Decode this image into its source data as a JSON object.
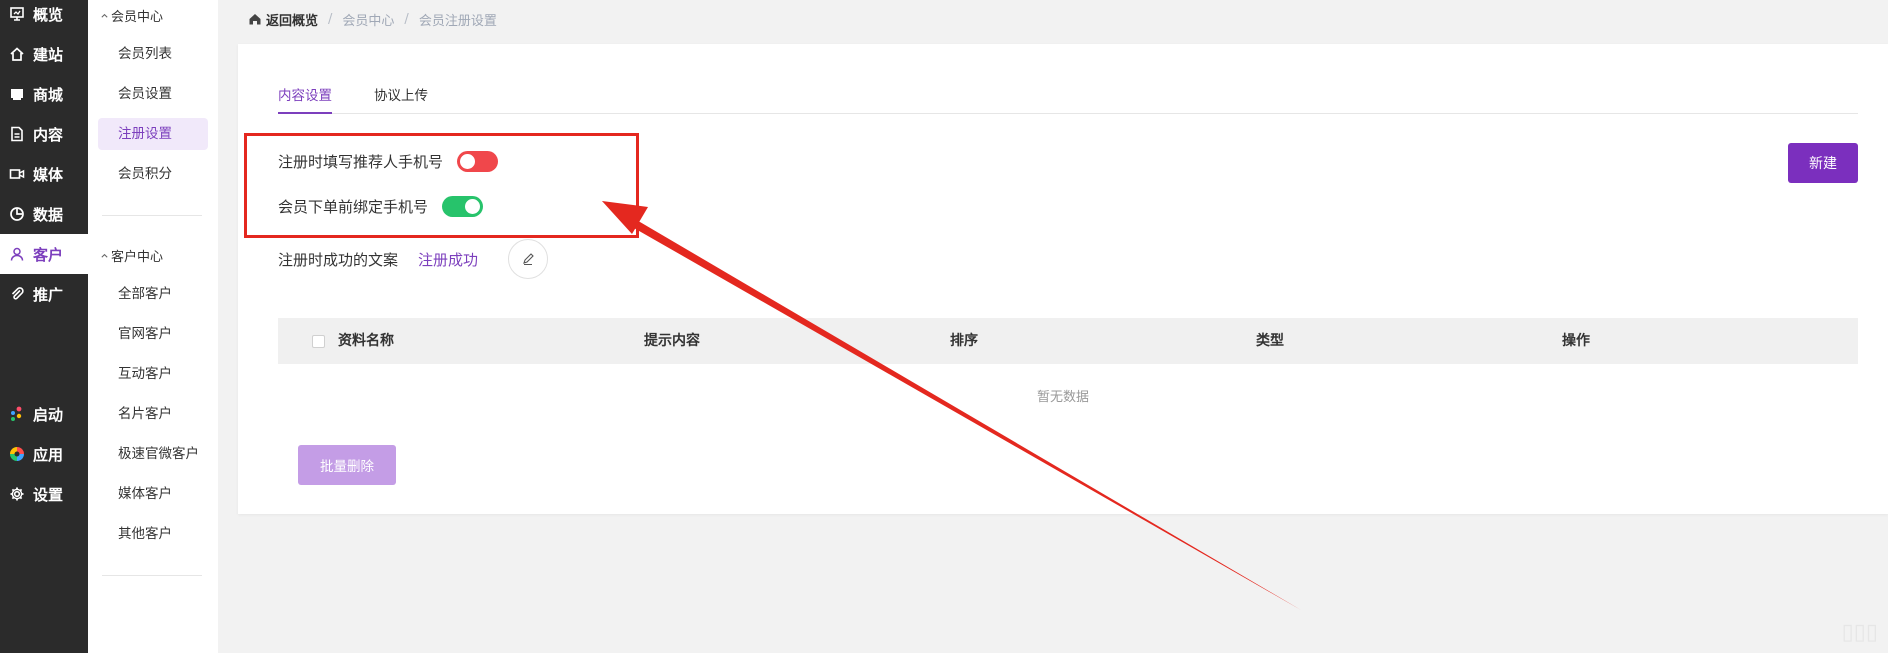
{
  "nav": {
    "items": [
      {
        "label": "概览",
        "icon": "monitor-icon"
      },
      {
        "label": "建站",
        "icon": "home-icon"
      },
      {
        "label": "商城",
        "icon": "store-icon"
      },
      {
        "label": "内容",
        "icon": "document-icon"
      },
      {
        "label": "媒体",
        "icon": "video-icon"
      },
      {
        "label": "数据",
        "icon": "pie-chart-icon"
      },
      {
        "label": "客户",
        "icon": "user-icon",
        "active": true
      },
      {
        "label": "推广",
        "icon": "paperclip-icon"
      },
      {
        "label": "启动",
        "icon": "launch-dots-icon"
      },
      {
        "label": "应用",
        "icon": "colorful-app-icon"
      },
      {
        "label": "设置",
        "icon": "gear-icon"
      }
    ]
  },
  "subnav": {
    "member_center": {
      "title": "会员中心",
      "items": [
        "会员列表",
        "会员设置",
        "注册设置",
        "会员积分"
      ]
    },
    "customer_center": {
      "title": "客户中心",
      "items": [
        "全部客户",
        "官网客户",
        "互动客户",
        "名片客户",
        "极速官微客户",
        "媒体客户",
        "其他客户"
      ]
    }
  },
  "breadcrumb": {
    "home": "返回概览",
    "items": [
      "会员中心",
      "会员注册设置"
    ]
  },
  "tabs": [
    "内容设置",
    "协议上传"
  ],
  "settings": {
    "referrer_phone": {
      "label": "注册时填写推荐人手机号",
      "enabled": false
    },
    "bind_phone": {
      "label": "会员下单前绑定手机号",
      "enabled": true
    },
    "success_text": {
      "label": "注册时成功的文案",
      "value": "注册成功"
    }
  },
  "buttons": {
    "new": "新建",
    "batch_delete": "批量删除"
  },
  "table": {
    "columns": [
      "资料名称",
      "提示内容",
      "排序",
      "类型",
      "操作"
    ],
    "empty": "暂无数据"
  },
  "colors": {
    "accent": "#7b2fbe",
    "switch_off": "#f0474b",
    "switch_on": "#27c36b",
    "annotation": "#e4281f"
  }
}
